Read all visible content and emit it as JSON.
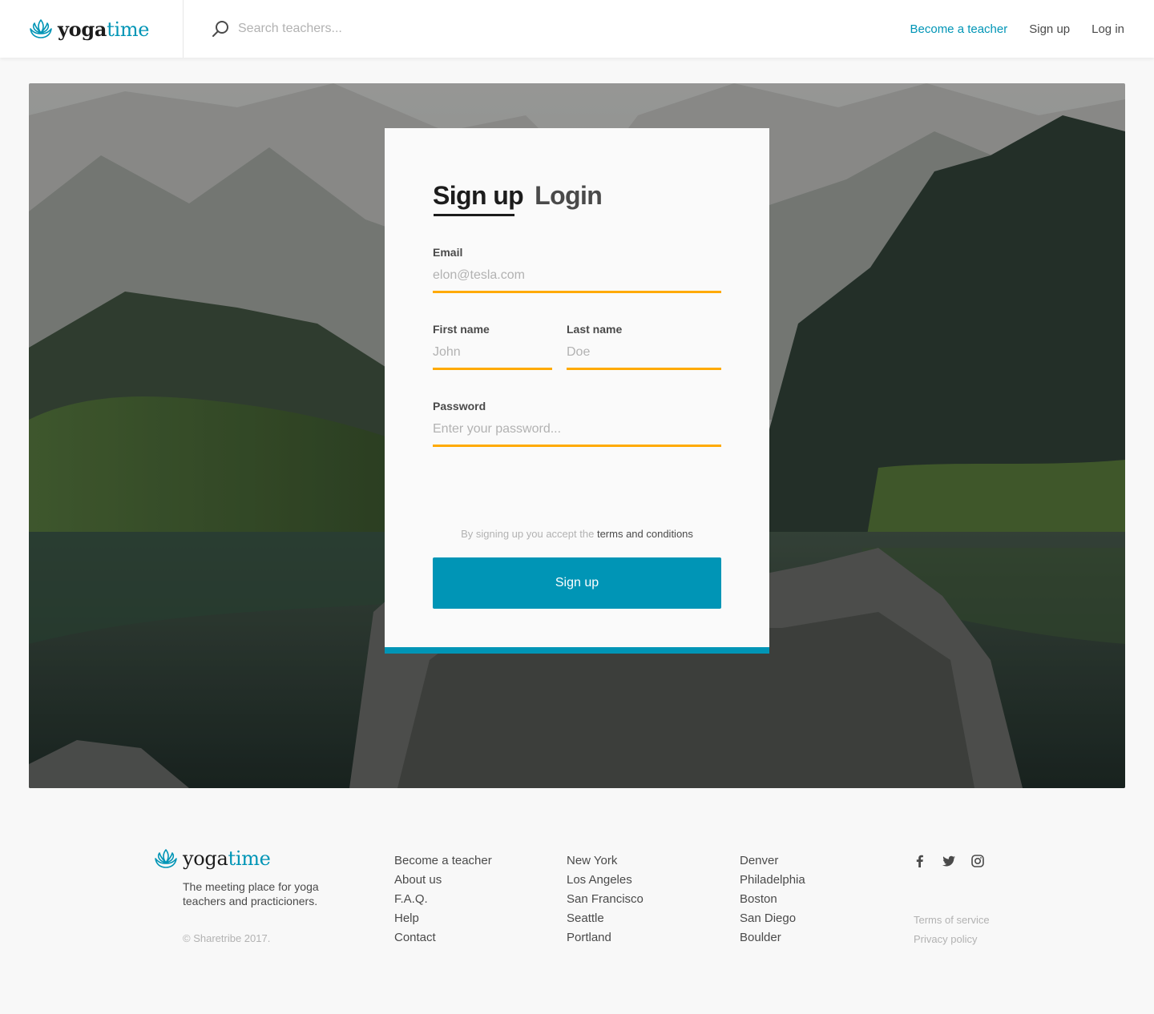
{
  "brand": {
    "name_part1": "yoga",
    "name_part2": "time",
    "accent_color": "#0095b6",
    "icon": "lotus-icon"
  },
  "search": {
    "placeholder": "Search teachers...",
    "icon": "search-icon"
  },
  "topnav": {
    "become_teacher": "Become a teacher",
    "sign_up": "Sign up",
    "log_in": "Log in"
  },
  "auth_card": {
    "tabs": [
      {
        "label": "Sign up",
        "active": true
      },
      {
        "label": "Login",
        "active": false
      }
    ],
    "fields": {
      "email": {
        "label": "Email",
        "placeholder": "elon@tesla.com",
        "value": ""
      },
      "first_name": {
        "label": "First name",
        "placeholder": "John",
        "value": ""
      },
      "last_name": {
        "label": "Last name",
        "placeholder": "Doe",
        "value": ""
      },
      "password": {
        "label": "Password",
        "placeholder": "Enter your password...",
        "value": ""
      }
    },
    "terms_prefix": "By signing up you accept the",
    "terms_link": "terms and conditions",
    "submit_label": "Sign up",
    "input_underline_color": "#ffaa00",
    "button_color": "#0095b6"
  },
  "footer": {
    "tagline": "The meeting place for yoga teachers and practicioners.",
    "copyright": "© Sharetribe 2017.",
    "links": [
      "Become a teacher",
      "About us",
      "F.A.Q.",
      "Help",
      "Contact"
    ],
    "cities_col1": [
      "New York",
      "Los Angeles",
      "San Francisco",
      "Seattle",
      "Portland"
    ],
    "cities_col2": [
      "Denver",
      "Philadelphia",
      "Boston",
      "San Diego",
      "Boulder"
    ],
    "social_icons": [
      "facebook-icon",
      "twitter-icon",
      "instagram-icon"
    ],
    "legal": [
      "Terms of service",
      "Privacy policy"
    ]
  }
}
